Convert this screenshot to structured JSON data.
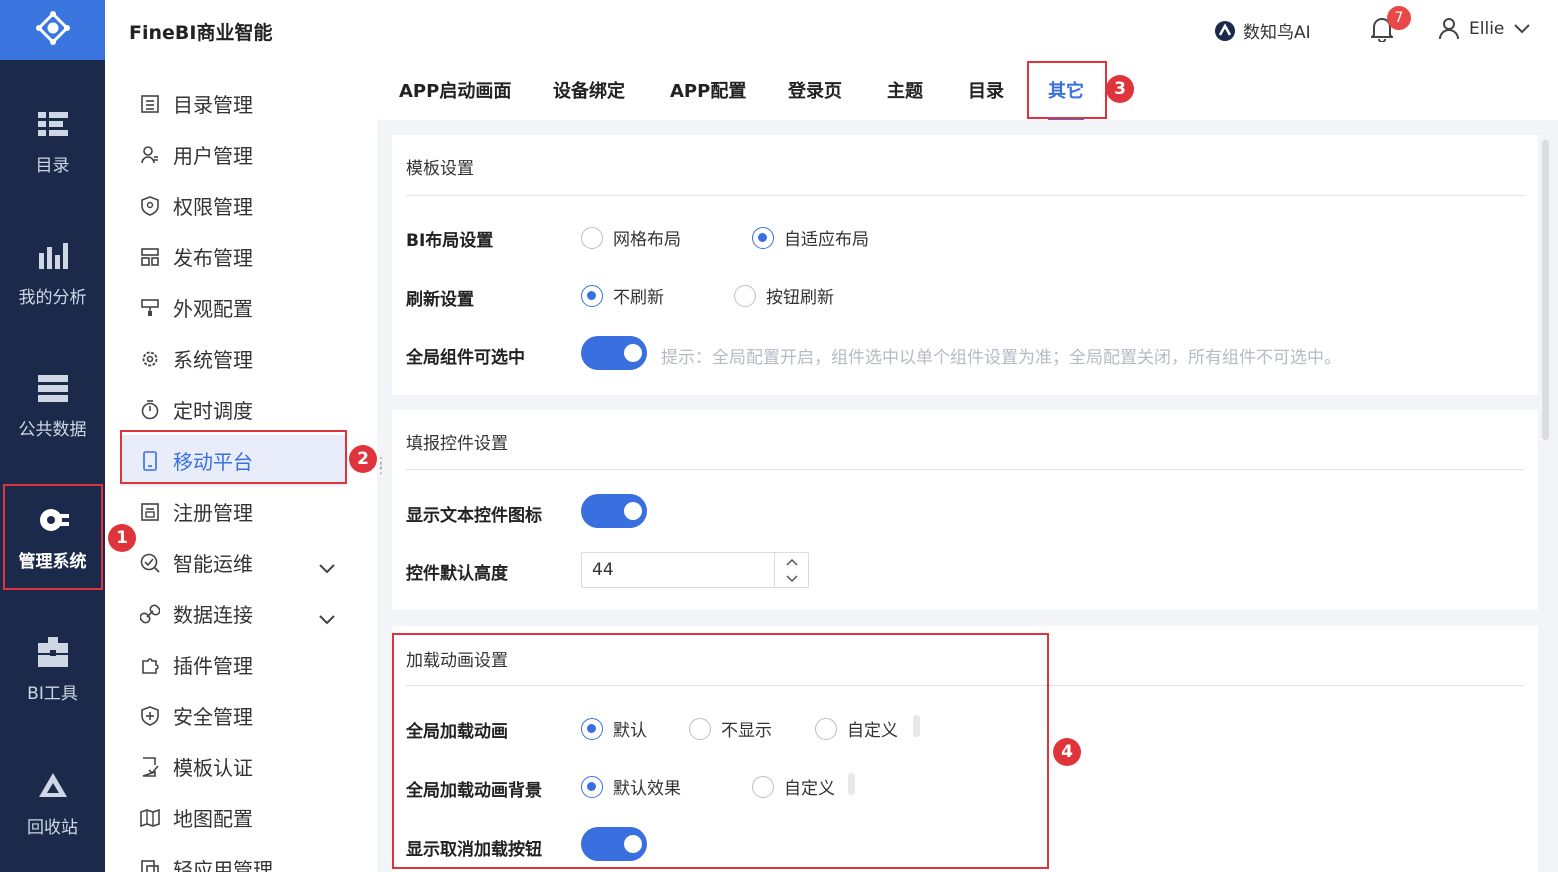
{
  "header": {
    "app_title": "FineBI商业智能",
    "ai_brand": "数知鸟AI",
    "notification_count": "7",
    "user_name": "Ellie"
  },
  "leftnav": {
    "items": [
      {
        "label": "目录",
        "icon": "catalog-icon"
      },
      {
        "label": "我的分析",
        "icon": "analysis-icon"
      },
      {
        "label": "公共数据",
        "icon": "public-data-icon"
      },
      {
        "label": "管理系统",
        "icon": "gear-icon"
      },
      {
        "label": "BI工具",
        "icon": "toolbox-icon"
      },
      {
        "label": "回收站",
        "icon": "recycle-bin-icon"
      }
    ],
    "active": "管理系统"
  },
  "submenu": {
    "items": [
      {
        "label": "目录管理",
        "icon": "list-icon"
      },
      {
        "label": "用户管理",
        "icon": "user-icon"
      },
      {
        "label": "权限管理",
        "icon": "shield-icon"
      },
      {
        "label": "发布管理",
        "icon": "publish-icon"
      },
      {
        "label": "外观配置",
        "icon": "brush-icon"
      },
      {
        "label": "系统管理",
        "icon": "gear-icon"
      },
      {
        "label": "定时调度",
        "icon": "timer-icon"
      },
      {
        "label": "移动平台",
        "icon": "mobile-icon"
      },
      {
        "label": "注册管理",
        "icon": "register-icon"
      },
      {
        "label": "智能运维",
        "icon": "ops-icon"
      },
      {
        "label": "数据连接",
        "icon": "link-icon"
      },
      {
        "label": "插件管理",
        "icon": "plugin-icon"
      },
      {
        "label": "安全管理",
        "icon": "security-icon"
      },
      {
        "label": "模板认证",
        "icon": "cert-icon"
      },
      {
        "label": "地图配置",
        "icon": "map-icon"
      },
      {
        "label": "轻应用管理",
        "icon": "app-icon"
      }
    ],
    "active": "移动平台"
  },
  "tabs": [
    {
      "label": "APP启动画面"
    },
    {
      "label": "设备绑定"
    },
    {
      "label": "APP配置"
    },
    {
      "label": "登录页"
    },
    {
      "label": "主题"
    },
    {
      "label": "目录"
    },
    {
      "label": "其它"
    }
  ],
  "active_tab": "其它",
  "template_settings": {
    "title": "模板设置",
    "bi_layout": {
      "label": "BI布局设置",
      "options": [
        "网格布局",
        "自适应布局"
      ],
      "selected": "自适应布局"
    },
    "refresh": {
      "label": "刷新设置",
      "options": [
        "不刷新",
        "按钮刷新"
      ],
      "selected": "不刷新"
    },
    "selectable": {
      "label": "全局组件可选中",
      "enabled": true,
      "hint": "提示：全局配置开启，组件选中以单个组件设置为准；全局配置关闭，所有组件不可选中。"
    }
  },
  "fill_settings": {
    "title": "填报控件设置",
    "show_icon": {
      "label": "显示文本控件图标",
      "enabled": true
    },
    "default_height": {
      "label": "控件默认高度",
      "value": "44"
    }
  },
  "loading_settings": {
    "title": "加载动画设置",
    "global_animation": {
      "label": "全局加载动画",
      "options": [
        "默认",
        "不显示",
        "自定义"
      ],
      "selected": "默认"
    },
    "animation_background": {
      "label": "全局加载动画背景",
      "options": [
        "默认效果",
        "自定义"
      ],
      "selected": "默认效果"
    },
    "show_cancel": {
      "label": "显示取消加载按钮",
      "enabled": true
    }
  },
  "annotations": [
    "1",
    "2",
    "3",
    "4"
  ],
  "colors": {
    "nav_bg": "#1b2a4a",
    "accent": "#3a6fe0",
    "annotation": "#e0343c"
  }
}
